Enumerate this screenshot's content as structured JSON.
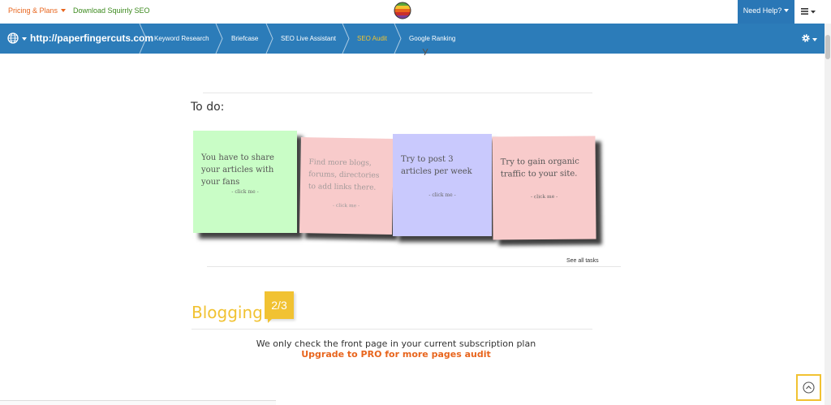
{
  "topbar": {
    "pricing_label": "Pricing & Plans",
    "download_label": "Download Squirrly SEO",
    "help_label": "Need Help?"
  },
  "nav": {
    "domain": "http://paperfingercuts.com",
    "crumbs": [
      "Keyword Research",
      "Briefcase",
      "SEO Live Assistant",
      "SEO Audit",
      "Google Ranking"
    ],
    "active_crumb": "SEO Audit"
  },
  "todo": {
    "label": "To do:",
    "notes": [
      {
        "text": "You have to share your articles with your fans",
        "action": "- click me -",
        "color": "#c9fdc6"
      },
      {
        "text": "Find more blogs, forums, directories to add links there.",
        "action": "- click me -",
        "color": "#f8cbcb"
      },
      {
        "text": "Try to post 3 articles per week",
        "action": "- click me -",
        "color": "#c9c9fd"
      },
      {
        "text": "Try to gain organic traffic to your site.",
        "action": "- click me -",
        "color": "#f8cbcb"
      }
    ],
    "see_all": "See all tasks"
  },
  "blogging": {
    "title": "Blogging",
    "score": "2/3",
    "notice": "We only check the front page in your current subscription plan",
    "upgrade": "Upgrade to PRO for more pages audit"
  },
  "colors": {
    "nav_bg": "#2c7cb9",
    "accent_orange": "#e8651d",
    "accent_yellow": "#f1c232",
    "download_green": "#3c8a1e"
  },
  "icons": [
    "globe-icon",
    "gear-icon",
    "hamburger-icon",
    "chevron-up-icon",
    "squirrly-logo"
  ]
}
